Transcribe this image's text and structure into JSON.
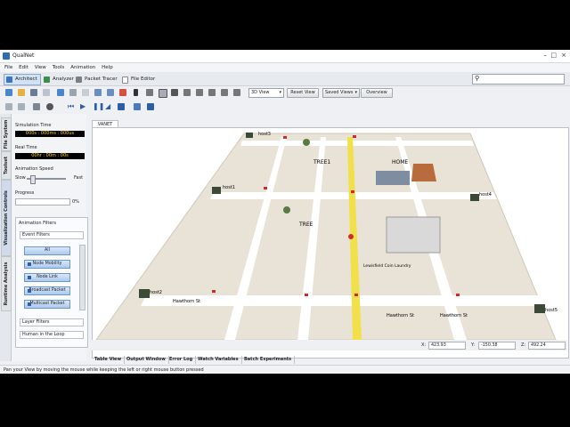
{
  "window": {
    "title": "QualNet"
  },
  "menu": [
    "File",
    "Edit",
    "View",
    "Tools",
    "Animation",
    "Help"
  ],
  "modes": [
    {
      "label": "Architect",
      "active": true,
      "color": "#3a74c4"
    },
    {
      "label": "Analyzer",
      "active": false,
      "color": "#3c8f4a"
    },
    {
      "label": "Packet Tracer",
      "active": false,
      "color": "#7a7f86"
    },
    {
      "label": "File Editor",
      "active": false,
      "color": "#d7dbe0"
    }
  ],
  "toolbar": {
    "view_select": "3D View",
    "reset_view": "Reset View",
    "saved_views": "Saved Views",
    "overview": "Overview"
  },
  "side_tabs": [
    "File System",
    "Toolset",
    "Visualization Controls",
    "Runtime Analysis"
  ],
  "panel": {
    "simulation_time_label": "Simulation Time",
    "simulation_time": "000s : 000ms : 000us",
    "real_time_label": "Real Time",
    "real_time": "00hr : 00m : 00s",
    "animation_speed_label": "Animation Speed",
    "slow": "Slow",
    "fast": "Fast",
    "progress_label": "Progress",
    "progress_value": "0%",
    "progress_fraction": 0,
    "animation_filters_label": "Animation Filters",
    "event_filters_label": "Event Filters",
    "filters": [
      "All",
      "Node Mobility",
      "Node Link",
      "Broadcast Packet",
      "Multicast Packet"
    ],
    "layer_filters": "Layer Filters",
    "human_in_loop": "Human in the Loop"
  },
  "scene": {
    "tab": "VANET",
    "labels": [
      "host3",
      "host1",
      "TREE1",
      "HOME",
      "host4",
      "TREE",
      "host2",
      "host5",
      "Lewisfield Coin Laundry",
      "Hawthorn St",
      "Hawthorn St",
      "Hawthorn St"
    ],
    "street_color": "#ffffff",
    "highlight_street_color": "#f1e04a"
  },
  "coords": {
    "x_label": "X:",
    "x": "423.93",
    "y_label": "Y:",
    "y": "-150.38",
    "z_label": "Z:",
    "z": "492.24"
  },
  "bottom_tabs": [
    "Table View",
    "Output Window",
    "Error Log",
    "Watch Variables",
    "Batch Experiments"
  ],
  "status": "Pan your View by moving the mouse while keeping the left or right mouse button pressed"
}
